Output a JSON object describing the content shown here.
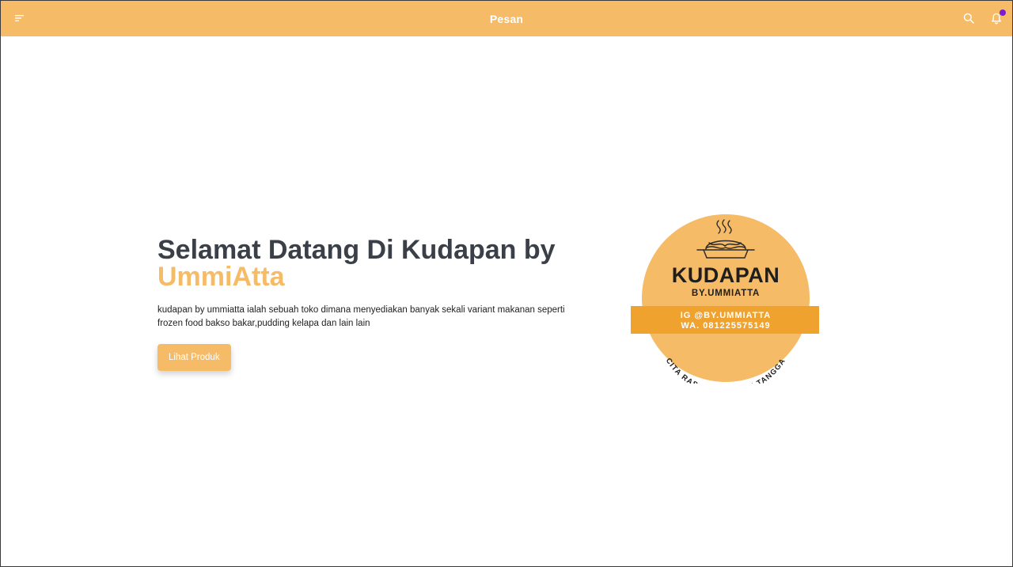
{
  "header": {
    "title": "Pesan",
    "menu_icon": "menu-icon",
    "search_icon": "search-icon",
    "notification_icon": "bell-icon",
    "background": "#f5bb67",
    "notification_dot_color": "#7a1bd6"
  },
  "hero": {
    "title": "Selamat Datang Di Kudapan by",
    "brand": "UmmiAtta",
    "description": "kudapan by ummiatta ialah sebuah toko dimana menyediakan banyak sekali variant makanan seperti frozen food bakso bakar,pudding kelapa dan lain lain",
    "button_label": "Lihat Produk",
    "accent": "#f5bb67"
  },
  "logo": {
    "name": "KUDAPAN",
    "sub": "BY.UMMIATTA",
    "ig": "IG @BY.UMMIATTA",
    "wa": "WA. 081225575149",
    "tagline": "CITA RASA IBU RUMAH TANGGA",
    "circle_color": "#f5bb67",
    "band_color": "#f0a22e"
  }
}
